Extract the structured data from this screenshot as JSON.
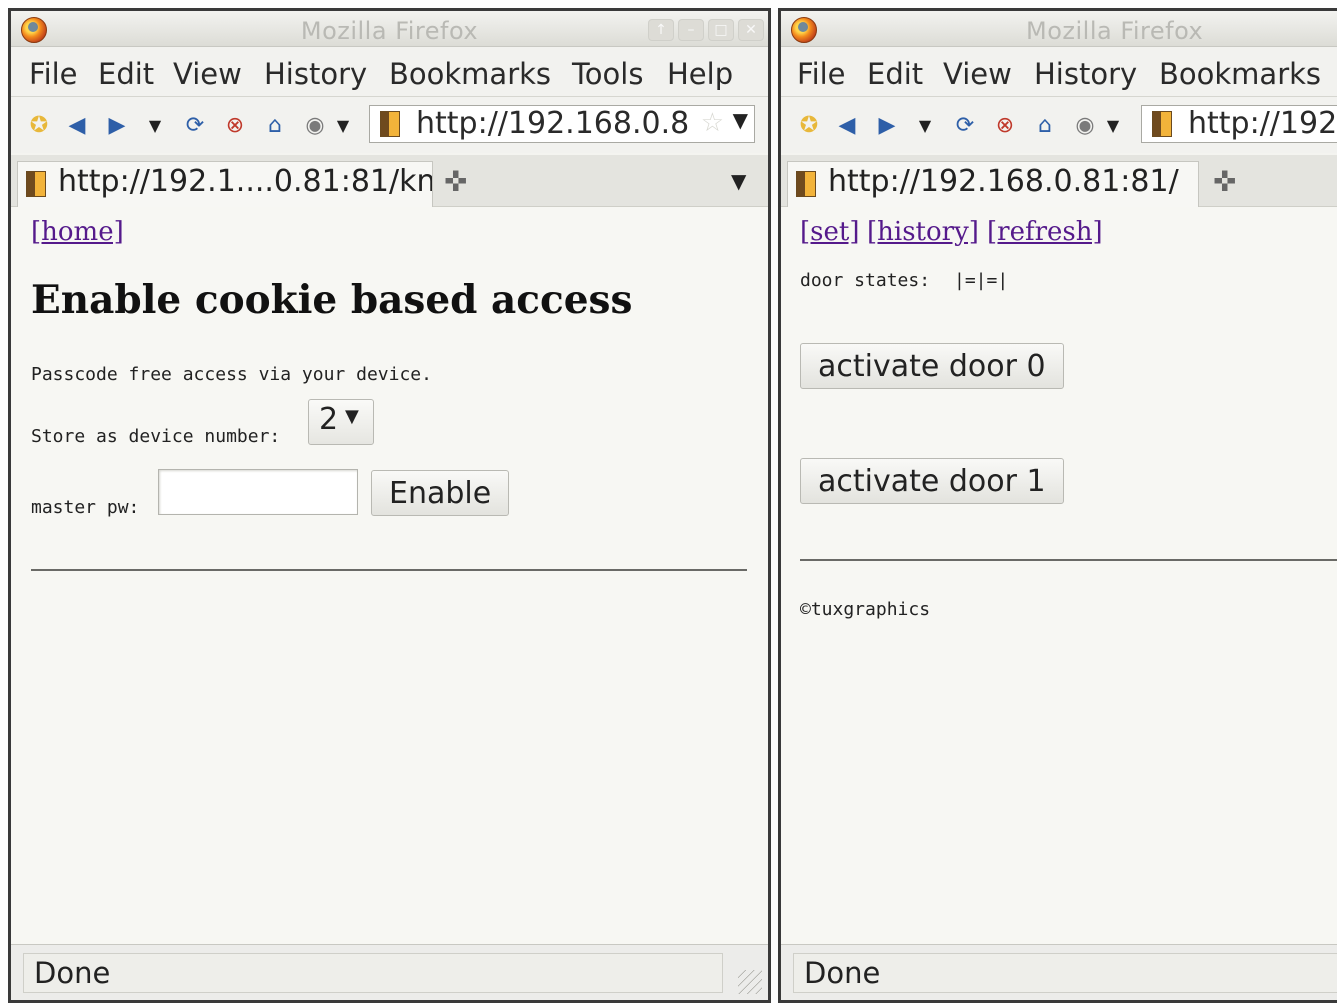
{
  "left_window": {
    "title": "Mozilla Firefox",
    "window_buttons": [
      "↑",
      "–",
      "□",
      "✕"
    ],
    "menu": [
      "File",
      "Edit",
      "View",
      "History",
      "Bookmarks",
      "Tools",
      "Help"
    ],
    "url": "http://192.168.0.8",
    "tab_title": "http://192.1....0.81:81/kn",
    "content": {
      "home_link": "[home]",
      "heading": "Enable cookie based access",
      "description": "Passcode free access via your device.",
      "device_label": "Store as device number:",
      "device_value": "2",
      "pw_label": "master pw:",
      "pw_value": "",
      "enable_button": "Enable"
    },
    "status": "Done"
  },
  "right_window": {
    "title": "Mozilla Firefox",
    "menu": [
      "File",
      "Edit",
      "View",
      "History",
      "Bookmarks"
    ],
    "url": "http://192",
    "tab_title": "http://192.168.0.81:81/",
    "content": {
      "links": [
        "[set]",
        "[history]",
        "[refresh]"
      ],
      "door_states_label": "door states:",
      "door_states_value": "|=|=|",
      "buttons": [
        "activate door 0",
        "activate door 1"
      ],
      "footer": "©tuxgraphics"
    },
    "status": "Done"
  },
  "icons": [
    "home-bookmark-icon",
    "back-icon",
    "forward-icon",
    "history-dropdown-icon",
    "reload-icon",
    "stop-icon",
    "home-icon",
    "globe-icon",
    "site-favicon",
    "bookmark-star-icon",
    "new-tab-icon",
    "firefox-logo-icon"
  ]
}
